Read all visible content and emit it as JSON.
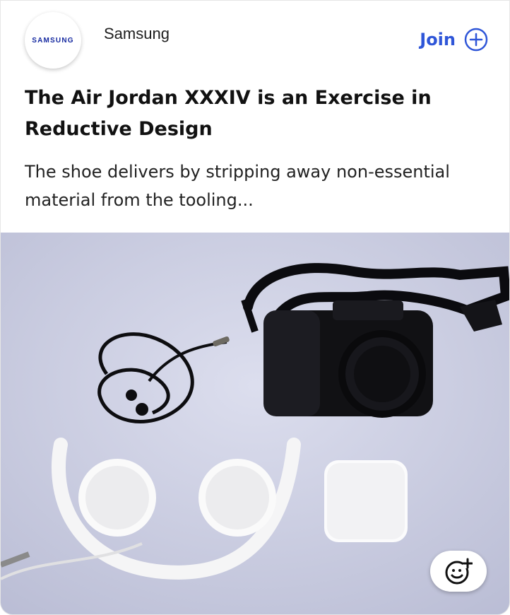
{
  "source": {
    "name": "Samsung",
    "logo_text": "SAMSUNG"
  },
  "join": {
    "label": "Join"
  },
  "article": {
    "title": "The Air Jordan XXXIV is an Exercise in Reductive Design",
    "summary": "The shoe delivers by stripping away non-essential material from the tooling..."
  },
  "colors": {
    "accent": "#2f56d8",
    "brand": "#1428a0",
    "photo_bg": "#cfd2e4"
  },
  "icons": {
    "join": "plus-circle-icon",
    "reaction": "add-reaction-icon"
  }
}
